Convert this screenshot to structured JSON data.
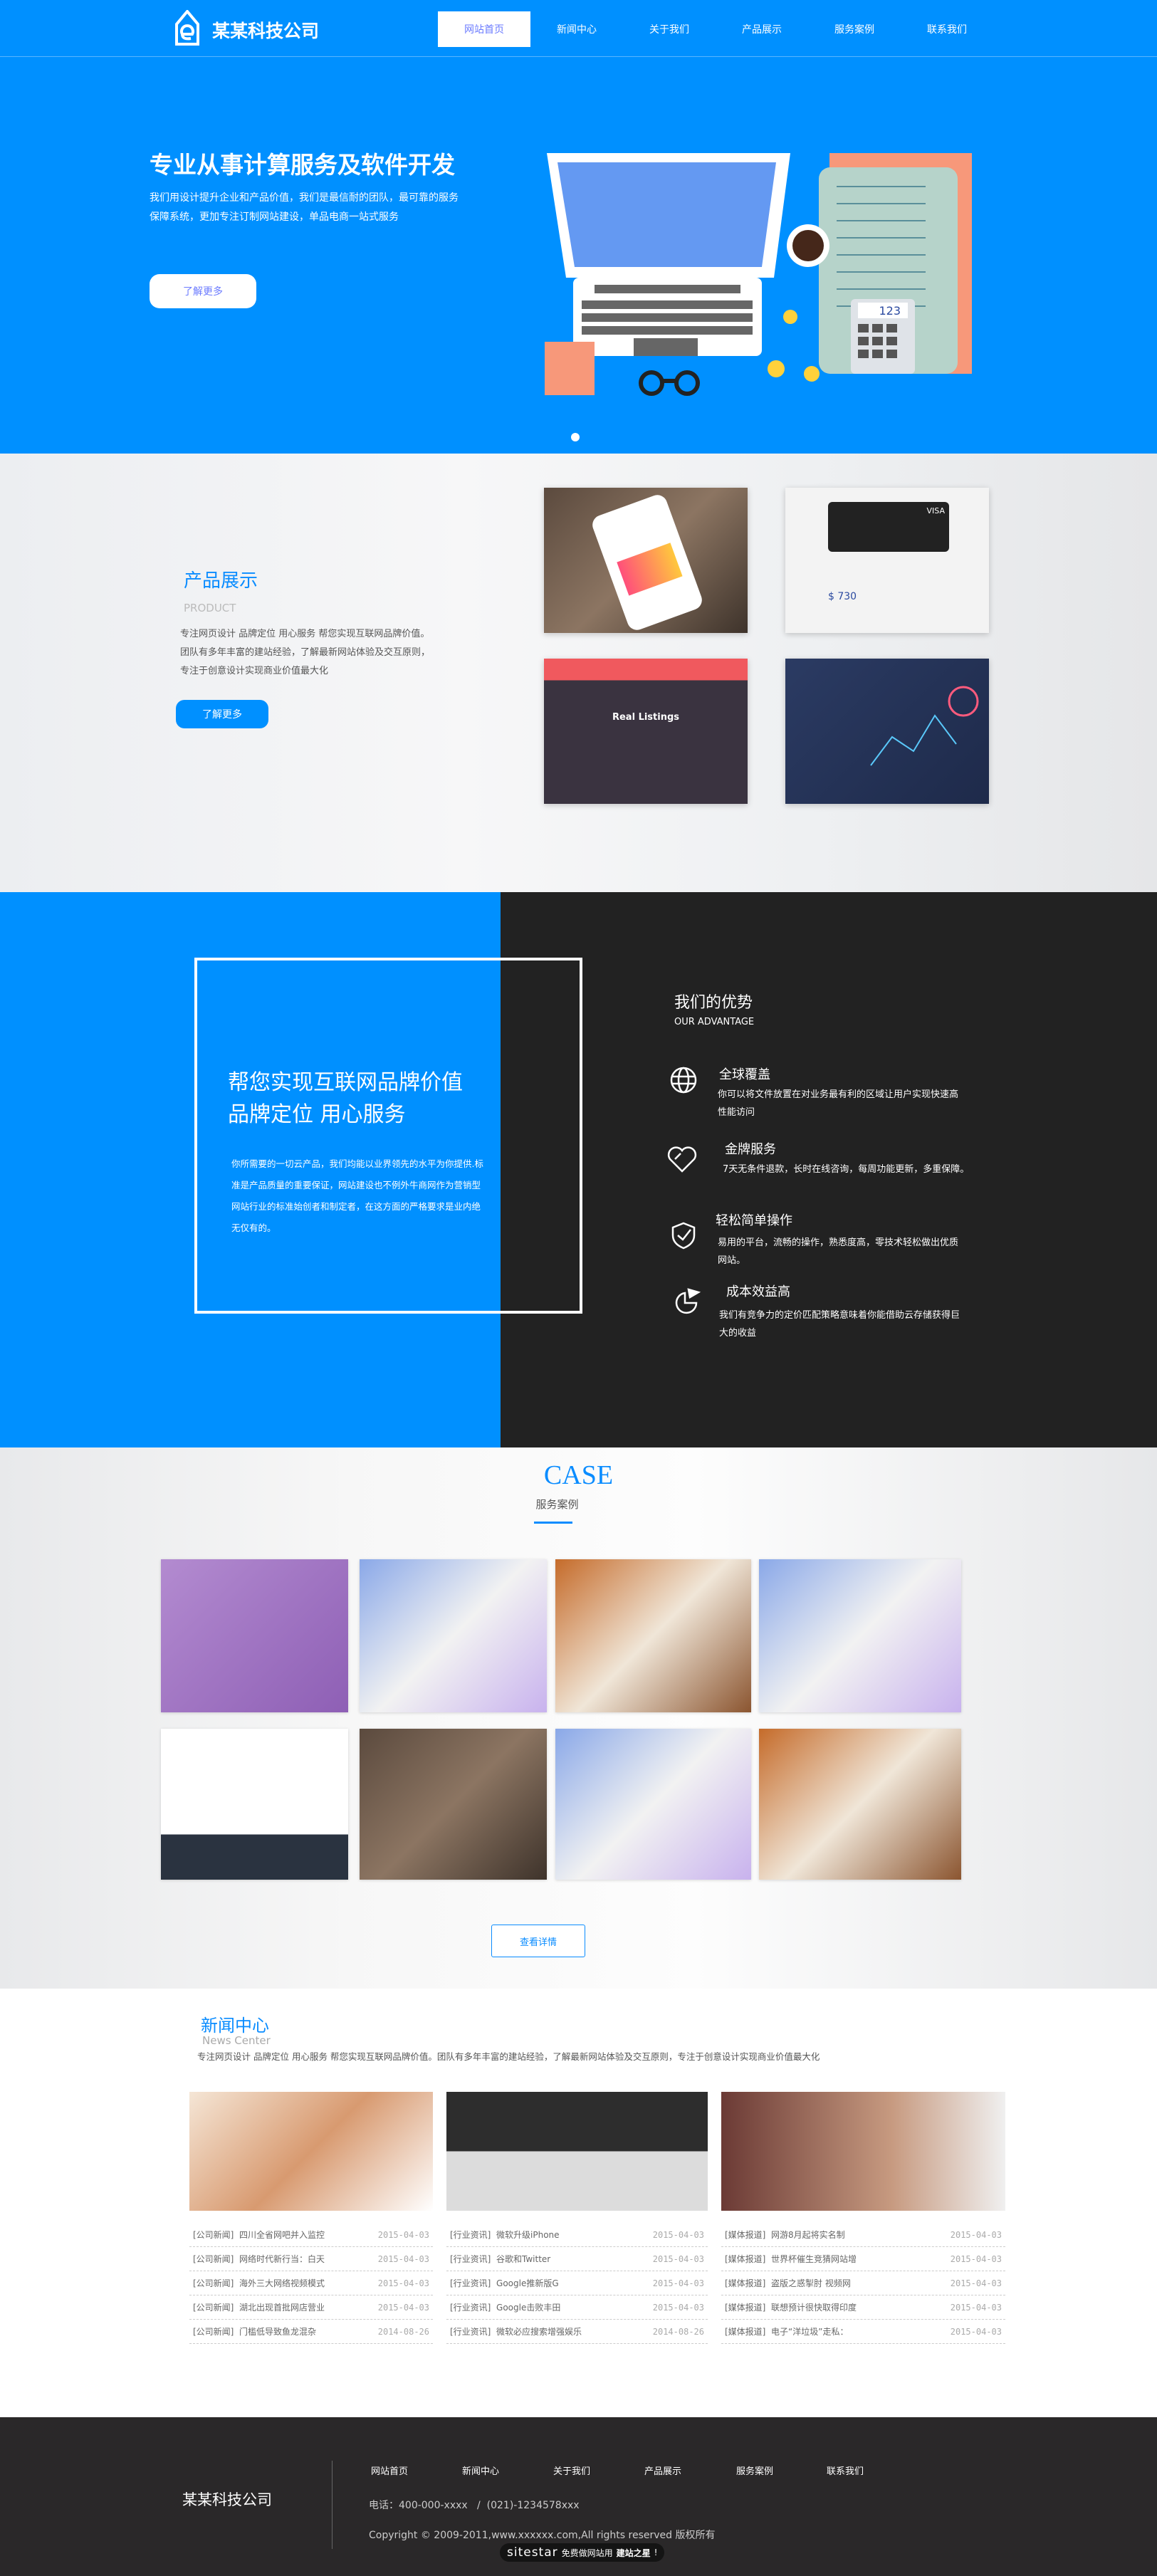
{
  "header": {
    "logo": "某某科技公司",
    "nav": [
      "网站首页",
      "新闻中心",
      "关于我们",
      "产品展示",
      "服务案例",
      "联系我们"
    ],
    "active_index": 0
  },
  "hero": {
    "title": "专业从事计算服务及软件开发",
    "desc": "我们用设计提升企业和产品价值，我们是最信耐的团队，最可靠的服务保障系统，更加专注订制网站建设，单品电商一站式服务",
    "button": "了解更多",
    "calculator_display": "123",
    "slide_count": 1
  },
  "products": {
    "title": "产品展示",
    "subtitle": "PRODUCT",
    "desc": "专注网页设计 品牌定位 用心服务 帮您实现互联网品牌价值。团队有多年丰富的建站经验，了解最新网站体验及交互原则，专注于创意设计实现商业价值最大化",
    "button": "了解更多",
    "thumb_texts": [
      "Real Listings",
      "$ 730",
      "VISA"
    ]
  },
  "advantage": {
    "slogan1": "帮您实现互联网品牌价值",
    "slogan2": "品牌定位 用心服务",
    "intro": "你所需要的一切云产品，我们均能以业界领先的水平为你提供.标准是产品质量的重要保证，网站建设也不例外牛商网作为营销型网站行业的标准始创者和制定者，在这方面的严格要求是业内绝无仅有的。",
    "title": "我们的优势",
    "subtitle": "OUR ADVANTAGE",
    "items": [
      {
        "icon": "globe-icon",
        "title": "全球覆盖",
        "desc": "你可以将文件放置在对业务最有利的区域让用户实现快速高性能访问"
      },
      {
        "icon": "heart-icon",
        "title": "金牌服务",
        "desc": "7天无条件退款，长时在线咨询，每周功能更新，多重保障。"
      },
      {
        "icon": "shield-check-icon",
        "title": "轻松简单操作",
        "desc": "易用的平台，流畅的操作，熟悉度高，零技术轻松做出优质网站。"
      },
      {
        "icon": "pie-chart-icon",
        "title": "成本效益高",
        "desc": "我们有竞争力的定价匹配策略意味着你能借助云存储获得巨大的收益"
      }
    ]
  },
  "cases": {
    "title": "CASE",
    "subtitle": "服务案例",
    "button": "查看详情"
  },
  "news": {
    "title": "新闻中心",
    "subtitle": "News Center",
    "desc": "专注网页设计 品牌定位 用心服务 帮您实现互联网品牌价值。团队有多年丰富的建站经验，了解最新网站体验及交互原则，专注于创意设计实现商业价值最大化",
    "columns": [
      {
        "items": [
          {
            "cat": "[公司新闻]",
            "title": "四川全省网吧并入监控",
            "date": "2015-04-03"
          },
          {
            "cat": "[公司新闻]",
            "title": "网络时代新行当：白天",
            "date": "2015-04-03"
          },
          {
            "cat": "[公司新闻]",
            "title": "海外三大网络视频模式",
            "date": "2015-04-03"
          },
          {
            "cat": "[公司新闻]",
            "title": "湖北出现首批网店营业",
            "date": "2015-04-03"
          },
          {
            "cat": "[公司新闻]",
            "title": "门槛低导致鱼龙混杂",
            "date": "2014-08-26"
          }
        ]
      },
      {
        "items": [
          {
            "cat": "[行业资讯]",
            "title": "微软升级iPhone",
            "date": "2015-04-03"
          },
          {
            "cat": "[行业资讯]",
            "title": "谷歌和Twitter",
            "date": "2015-04-03"
          },
          {
            "cat": "[行业资讯]",
            "title": "Google推新版G",
            "date": "2015-04-03"
          },
          {
            "cat": "[行业资讯]",
            "title": "Google击败丰田",
            "date": "2015-04-03"
          },
          {
            "cat": "[行业资讯]",
            "title": "微软必应搜索增强娱乐",
            "date": "2014-08-26"
          }
        ]
      },
      {
        "items": [
          {
            "cat": "[媒体报道]",
            "title": "网游8月起将实名制",
            "date": "2015-04-03"
          },
          {
            "cat": "[媒体报道]",
            "title": "世界杯催生竞猜网站增",
            "date": "2015-04-03"
          },
          {
            "cat": "[媒体报道]",
            "title": "盗版之惑掣肘 视频网",
            "date": "2015-04-03"
          },
          {
            "cat": "[媒体报道]",
            "title": "联想预计很快取得印度",
            "date": "2015-04-03"
          },
          {
            "cat": "[媒体报道]",
            "title": "电子“洋垃圾”走私：",
            "date": "2015-04-03"
          }
        ]
      }
    ]
  },
  "footer": {
    "logo": "某某科技公司",
    "nav": [
      "网站首页",
      "新闻中心",
      "关于我们",
      "产品展示",
      "服务案例",
      "联系我们"
    ],
    "phone": "电话：400-000-xxxx   /  (021)-1234578xxx",
    "copyright": "Copyright © 2009-2011,www.xxxxxx.com,All rights reserved  版权所有",
    "badge_brand": "sitestar",
    "badge_text": "免费做网站用",
    "badge_strong": "建站之星",
    "badge_end": "!"
  },
  "colors": {
    "primary": "#0090ff",
    "dark": "#222222",
    "footer": "#2a2829"
  }
}
